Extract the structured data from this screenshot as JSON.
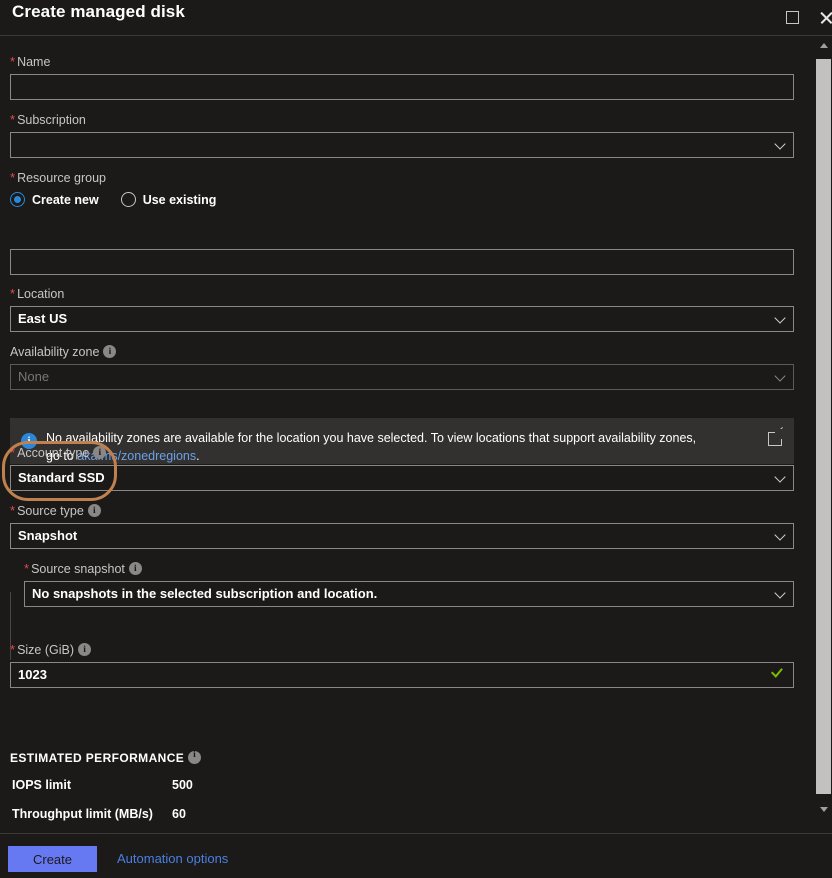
{
  "window": {
    "title": "Create managed disk",
    "maximize_icon": "maximize-icon",
    "close_icon": "close-icon"
  },
  "form": {
    "name": {
      "label": "Name",
      "required": true,
      "value": "",
      "placeholder": ""
    },
    "subscription": {
      "label": "Subscription",
      "required": true,
      "value": "",
      "placeholder": ""
    },
    "resource_group": {
      "label": "Resource group",
      "required": true,
      "options": [
        {
          "label": "Create new",
          "selected": true
        },
        {
          "label": "Use existing",
          "selected": false
        }
      ],
      "value": "",
      "placeholder": ""
    },
    "location": {
      "label": "Location",
      "required": true,
      "value": "East US"
    },
    "availability_zone": {
      "label": "Availability zone",
      "required": false,
      "has_info": true,
      "value": "None",
      "disabled": true
    },
    "banner": {
      "text_before": "No availability zones are available for the location you have selected. To view locations that support availability zones, go to ",
      "link": "aka.ms/zonedregions",
      "text_after": ".",
      "info_icon": "info-icon",
      "external_icon": "external-link-icon"
    },
    "account_type": {
      "label": "Account type",
      "required": true,
      "has_info": true,
      "value": "Standard SSD",
      "highlighted": true
    },
    "source_type": {
      "label": "Source type",
      "required": true,
      "has_info": true,
      "value": "Snapshot"
    },
    "source_snapshot": {
      "label": "Source snapshot",
      "required": true,
      "has_info": true,
      "value": "No snapshots in the selected subscription and location."
    },
    "size": {
      "label": "Size (GiB)",
      "required": true,
      "has_info": true,
      "value": "1023",
      "valid": true
    }
  },
  "performance": {
    "title": "ESTIMATED PERFORMANCE",
    "has_info": true,
    "rows": [
      {
        "name": "IOPS limit",
        "value": "500"
      },
      {
        "name": "Throughput limit (MB/s)",
        "value": "60"
      }
    ]
  },
  "footer": {
    "create_label": "Create",
    "automation_label": "Automation options"
  },
  "colors": {
    "accent": "#6679f2",
    "link": "#4a7fe0",
    "required_asterisk": "#e74856",
    "info": "#2b88d8",
    "valid": "#7cbb00",
    "highlight_annotation": "#c0814e",
    "banner_bg": "#323130",
    "page_bg": "#1b1a19"
  }
}
